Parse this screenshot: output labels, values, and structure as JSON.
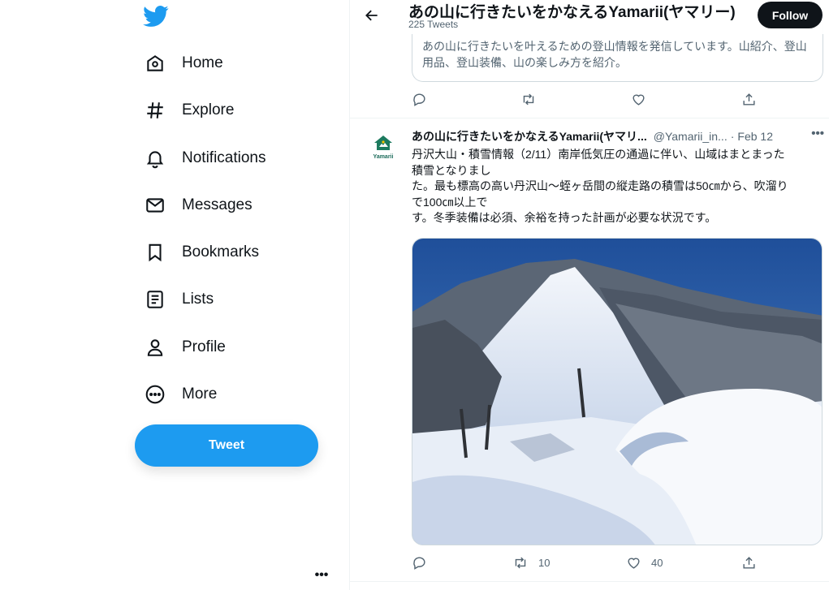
{
  "sidebar": {
    "nav": [
      {
        "label": "Home",
        "icon": "home-icon"
      },
      {
        "label": "Explore",
        "icon": "hashtag-icon"
      },
      {
        "label": "Notifications",
        "icon": "bell-icon"
      },
      {
        "label": "Messages",
        "icon": "envelope-icon"
      },
      {
        "label": "Bookmarks",
        "icon": "bookmark-icon"
      },
      {
        "label": "Lists",
        "icon": "list-icon"
      },
      {
        "label": "Profile",
        "icon": "person-icon"
      },
      {
        "label": "More",
        "icon": "more-circle-icon"
      }
    ],
    "tweet_button": "Tweet",
    "account_more": "•••"
  },
  "header": {
    "title": "あの山に行きたいをかなえるYamarii(ヤマリー)",
    "subtitle": "225 Tweets",
    "follow_label": "Follow"
  },
  "quoted": {
    "text": "あの山に行きたいを叶えるための登山情報を発信しています。山紹介、登山用品、登山装備、山の楽しみ方を紹介。"
  },
  "tweet": {
    "author": "あの山に行きたいをかなえるYamarii(ヤマリ...",
    "handle": "@Yamarii_in...",
    "dot": "·",
    "date": "Feb 12",
    "more": "•••",
    "avatar_brand": "Yamarii",
    "lines": [
      "丹沢大山・積雪情報（2/11）南岸低気圧の通過に伴い、山域はまとまった",
      "積雪となりまし",
      "た。最も標高の高い丹沢山〜蛭ヶ岳間の縦走路の積雪は50㎝から、吹溜り",
      "で100㎝以上で",
      "す。冬季装備は必須、余裕を持った計画が必要な状況です。"
    ],
    "retweets": "10",
    "likes": "40"
  },
  "colors": {
    "accent": "#1d9bf0",
    "text": "#0f1419",
    "muted": "#536471",
    "border": "#eff3f4"
  }
}
